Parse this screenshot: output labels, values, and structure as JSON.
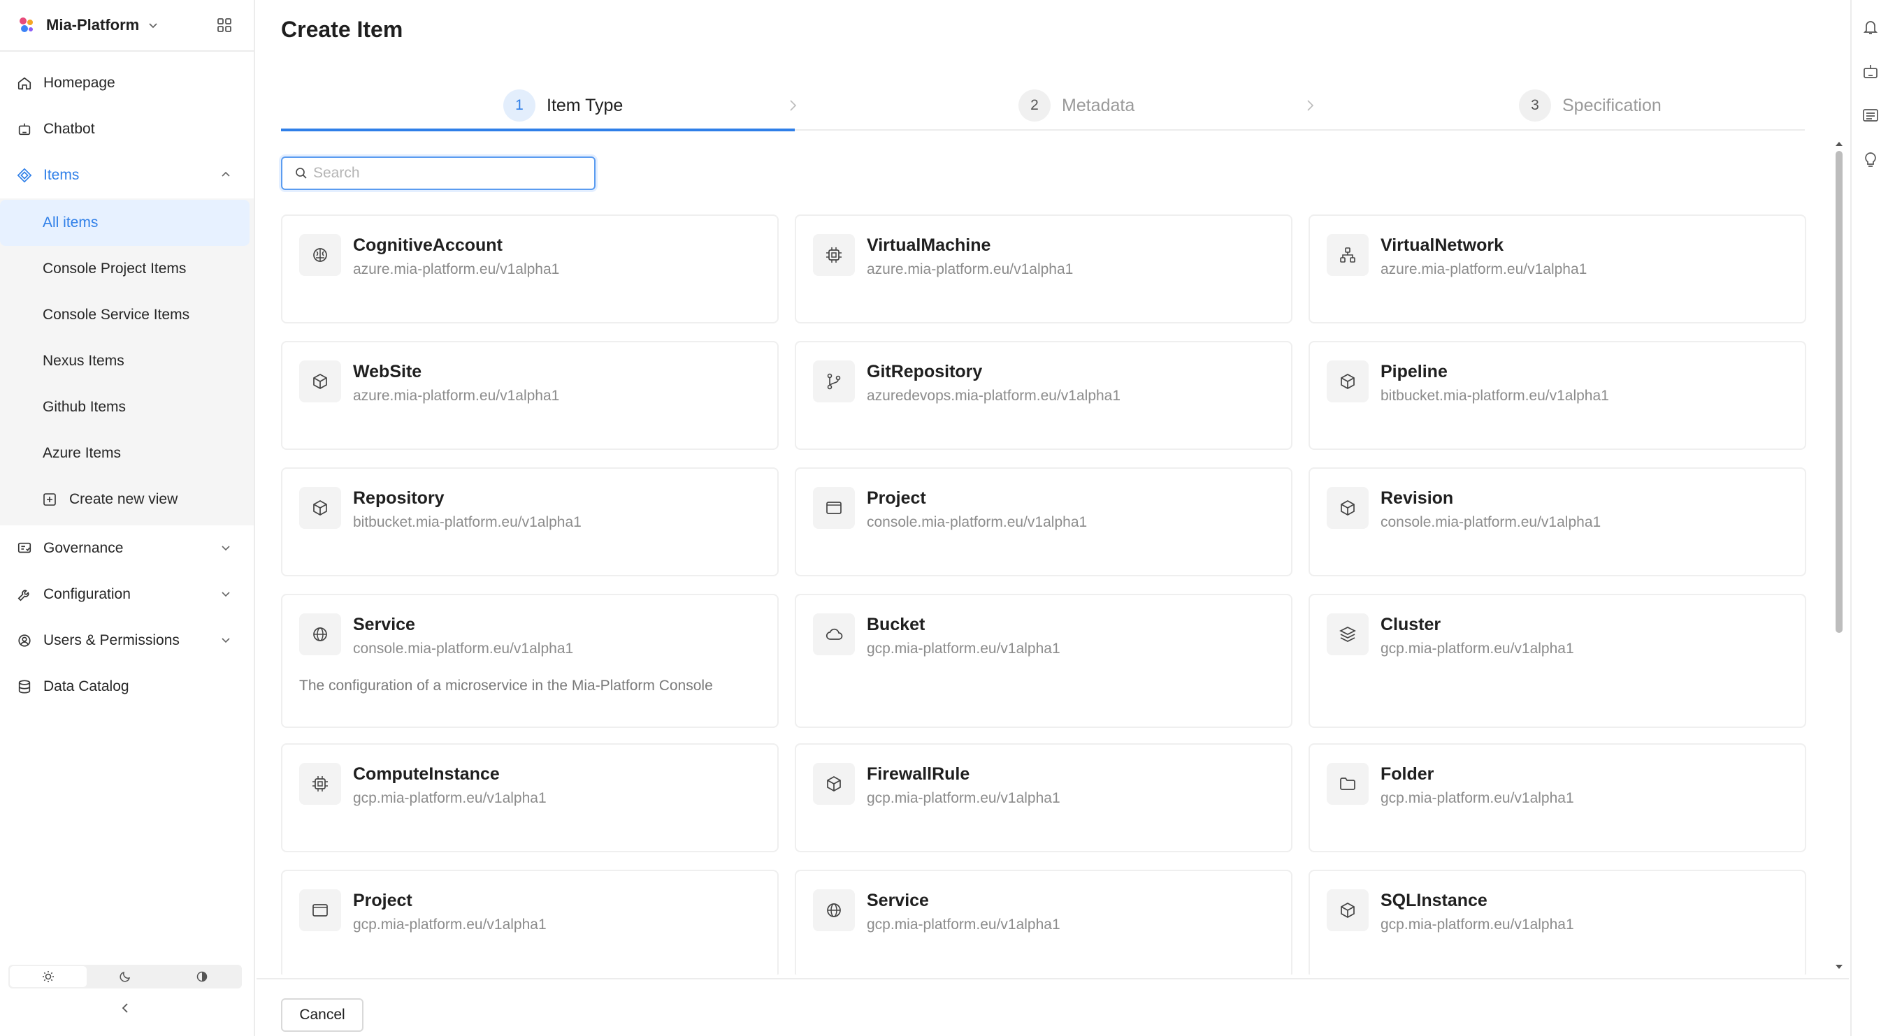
{
  "brand": {
    "name": "Mia-Platform"
  },
  "sidebar": {
    "items": [
      {
        "label": "Homepage",
        "icon": "home-icon"
      },
      {
        "label": "Chatbot",
        "icon": "robot-icon"
      },
      {
        "label": "Items",
        "icon": "diamond-icon"
      }
    ],
    "subitems": [
      {
        "label": "All items"
      },
      {
        "label": "Console Project Items"
      },
      {
        "label": "Console Service Items"
      },
      {
        "label": "Nexus Items"
      },
      {
        "label": "Github Items"
      },
      {
        "label": "Azure Items"
      },
      {
        "label": "Create new view"
      }
    ],
    "bottom_items": [
      {
        "label": "Governance",
        "icon": "governance-icon"
      },
      {
        "label": "Configuration",
        "icon": "wrench-icon"
      },
      {
        "label": "Users & Permissions",
        "icon": "users-gear-icon"
      },
      {
        "label": "Data Catalog",
        "icon": "database-icon"
      }
    ]
  },
  "page": {
    "title": "Create Item"
  },
  "steps": [
    {
      "num": "1",
      "label": "Item Type"
    },
    {
      "num": "2",
      "label": "Metadata"
    },
    {
      "num": "3",
      "label": "Specification"
    }
  ],
  "search": {
    "placeholder": "Search",
    "value": ""
  },
  "cards": [
    {
      "name": "CognitiveAccount",
      "group": "azure.mia-platform.eu/v1alpha1",
      "icon": "brain-icon"
    },
    {
      "name": "VirtualMachine",
      "group": "azure.mia-platform.eu/v1alpha1",
      "icon": "cpu-icon"
    },
    {
      "name": "VirtualNetwork",
      "group": "azure.mia-platform.eu/v1alpha1",
      "icon": "network-icon"
    },
    {
      "name": "WebSite",
      "group": "azure.mia-platform.eu/v1alpha1",
      "icon": "box-icon"
    },
    {
      "name": "GitRepository",
      "group": "azuredevops.mia-platform.eu/v1alpha1",
      "icon": "git-branch-icon"
    },
    {
      "name": "Pipeline",
      "group": "bitbucket.mia-platform.eu/v1alpha1",
      "icon": "box-icon"
    },
    {
      "name": "Repository",
      "group": "bitbucket.mia-platform.eu/v1alpha1",
      "icon": "box-icon"
    },
    {
      "name": "Project",
      "group": "console.mia-platform.eu/v1alpha1",
      "icon": "window-icon"
    },
    {
      "name": "Revision",
      "group": "console.mia-platform.eu/v1alpha1",
      "icon": "box-icon"
    },
    {
      "name": "Service",
      "group": "console.mia-platform.eu/v1alpha1",
      "icon": "globe-icon",
      "description": "The configuration of a microservice in the Mia-Platform Console"
    },
    {
      "name": "Bucket",
      "group": "gcp.mia-platform.eu/v1alpha1",
      "icon": "cloud-icon"
    },
    {
      "name": "Cluster",
      "group": "gcp.mia-platform.eu/v1alpha1",
      "icon": "layers-icon"
    },
    {
      "name": "ComputeInstance",
      "group": "gcp.mia-platform.eu/v1alpha1",
      "icon": "cpu-icon"
    },
    {
      "name": "FirewallRule",
      "group": "gcp.mia-platform.eu/v1alpha1",
      "icon": "box-icon"
    },
    {
      "name": "Folder",
      "group": "gcp.mia-platform.eu/v1alpha1",
      "icon": "folder-icon"
    },
    {
      "name": "Project",
      "group": "gcp.mia-platform.eu/v1alpha1",
      "icon": "window-icon"
    },
    {
      "name": "Service",
      "group": "gcp.mia-platform.eu/v1alpha1",
      "icon": "globe-icon"
    },
    {
      "name": "SQLInstance",
      "group": "gcp.mia-platform.eu/v1alpha1",
      "icon": "box-icon"
    }
  ],
  "footer": {
    "cancel_label": "Cancel"
  },
  "colors": {
    "accent": "#2f7fe8",
    "selected_bg": "#e7f1ff"
  }
}
